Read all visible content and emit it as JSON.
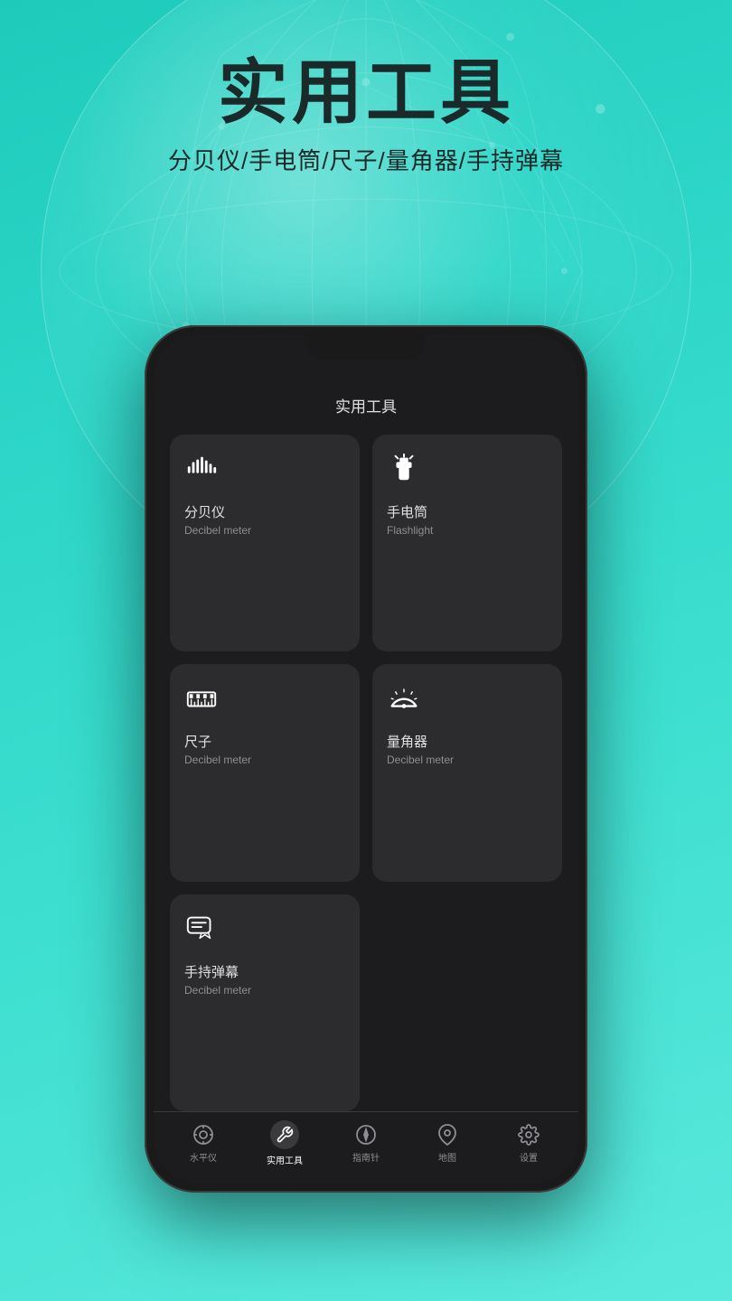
{
  "background": {
    "gradient_start": "#1ecbbb",
    "gradient_end": "#5ae8dc"
  },
  "header": {
    "title": "实用工具",
    "subtitle": "分贝仪/手电筒/尺子/量角器/手持弹幕"
  },
  "phone": {
    "screen_title": "实用工具",
    "tools": [
      {
        "id": "decibel",
        "name_cn": "分贝仪",
        "name_en": "Decibel meter",
        "icon": "decibel"
      },
      {
        "id": "flashlight",
        "name_cn": "手电筒",
        "name_en": "Flashlight",
        "icon": "flashlight"
      },
      {
        "id": "ruler",
        "name_cn": "尺子",
        "name_en": "Decibel meter",
        "icon": "ruler"
      },
      {
        "id": "protractor",
        "name_cn": "量角器",
        "name_en": "Decibel meter",
        "icon": "protractor"
      },
      {
        "id": "danmu",
        "name_cn": "手持弹幕",
        "name_en": "Decibel meter",
        "icon": "danmu"
      }
    ],
    "nav": [
      {
        "id": "level",
        "label": "水平仪",
        "active": false
      },
      {
        "id": "tools",
        "label": "实用工具",
        "active": true
      },
      {
        "id": "compass",
        "label": "指南针",
        "active": false
      },
      {
        "id": "map",
        "label": "地图",
        "active": false
      },
      {
        "id": "settings",
        "label": "设置",
        "active": false
      }
    ]
  }
}
